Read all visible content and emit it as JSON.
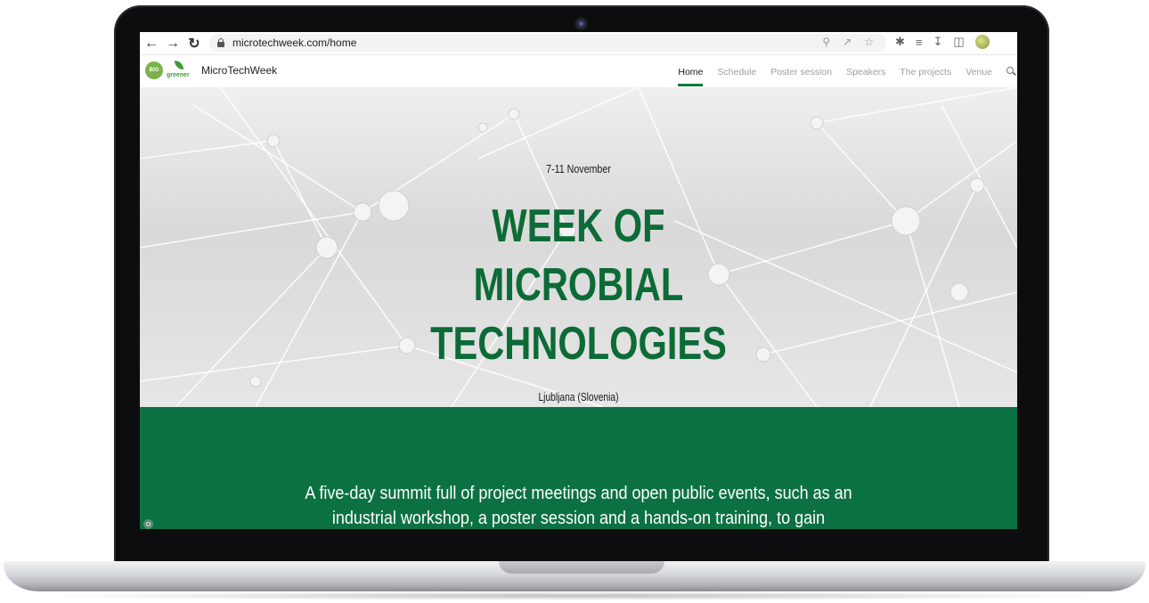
{
  "browser": {
    "url": "microtechweek.com/home"
  },
  "site": {
    "logo_text": "BIO",
    "logo_sub": "greener",
    "brand": "MicroTechWeek",
    "menu": [
      {
        "label": "Home"
      },
      {
        "label": "Schedule"
      },
      {
        "label": "Poster session"
      },
      {
        "label": "Speakers"
      },
      {
        "label": "The projects"
      },
      {
        "label": "Venue"
      }
    ]
  },
  "hero": {
    "date": "7-11 November",
    "title_line1": "WEEK OF",
    "title_line2": "MICROBIAL",
    "title_line3": "TECHNOLOGIES",
    "place": "Ljubljana (Slovenia)"
  },
  "intro": {
    "line1": "A five-day summit full of project meetings and open public events, such as an",
    "line2": "industrial workshop, a poster session and a hands-on training, to gain"
  },
  "colors": {
    "accent": "#0c7142",
    "title": "#0c6b36"
  },
  "icons": [
    "back-arrow-icon",
    "forward-arrow-icon",
    "reload-icon",
    "lock-icon",
    "zoom-icon",
    "share-icon",
    "star-icon",
    "extensions-icon",
    "reading-list-icon",
    "download-icon",
    "side-panel-icon",
    "profile-avatar-icon",
    "search-icon"
  ]
}
